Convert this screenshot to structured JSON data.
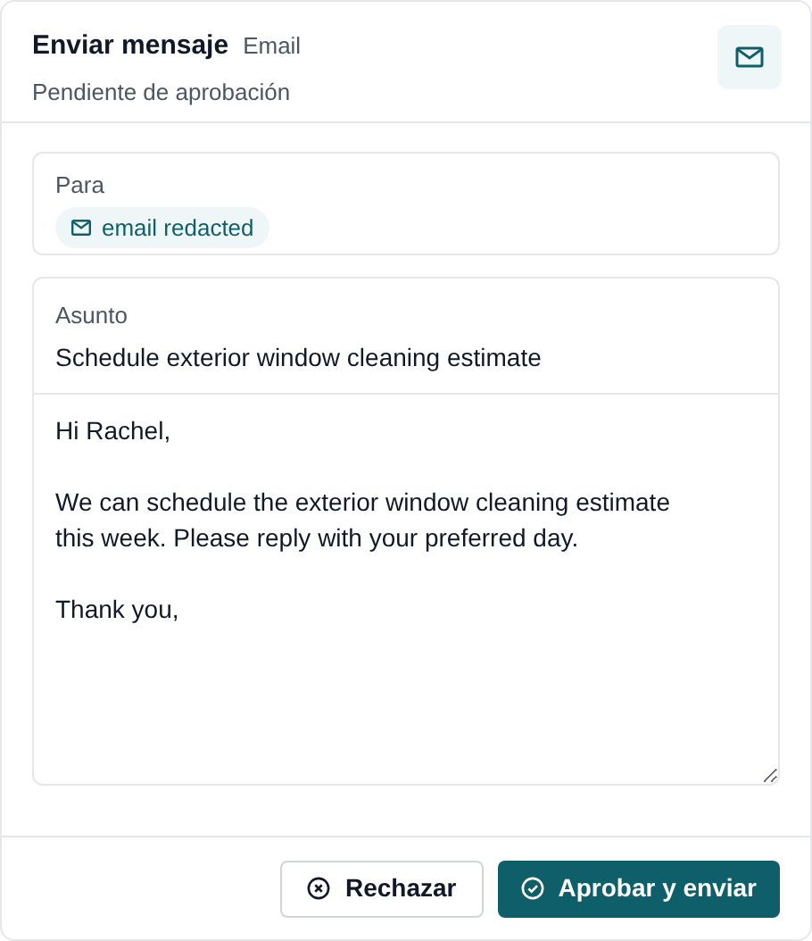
{
  "header": {
    "title": "Enviar mensaje",
    "channel": "Email",
    "status": "Pendiente de aprobación"
  },
  "to": {
    "label": "Para",
    "recipients": [
      "email redacted"
    ]
  },
  "subject": {
    "label": "Asunto",
    "value": "Schedule exterior window cleaning estimate"
  },
  "body": "Hi Rachel,\n\nWe can schedule the exterior window cleaning estimate this week. Please reply with your preferred day.\n\nThank you,",
  "buttons": [
    {
      "label": "Rechazar",
      "kind": "reject"
    },
    {
      "label": "Aprobar y enviar",
      "kind": "approve"
    }
  ]
}
